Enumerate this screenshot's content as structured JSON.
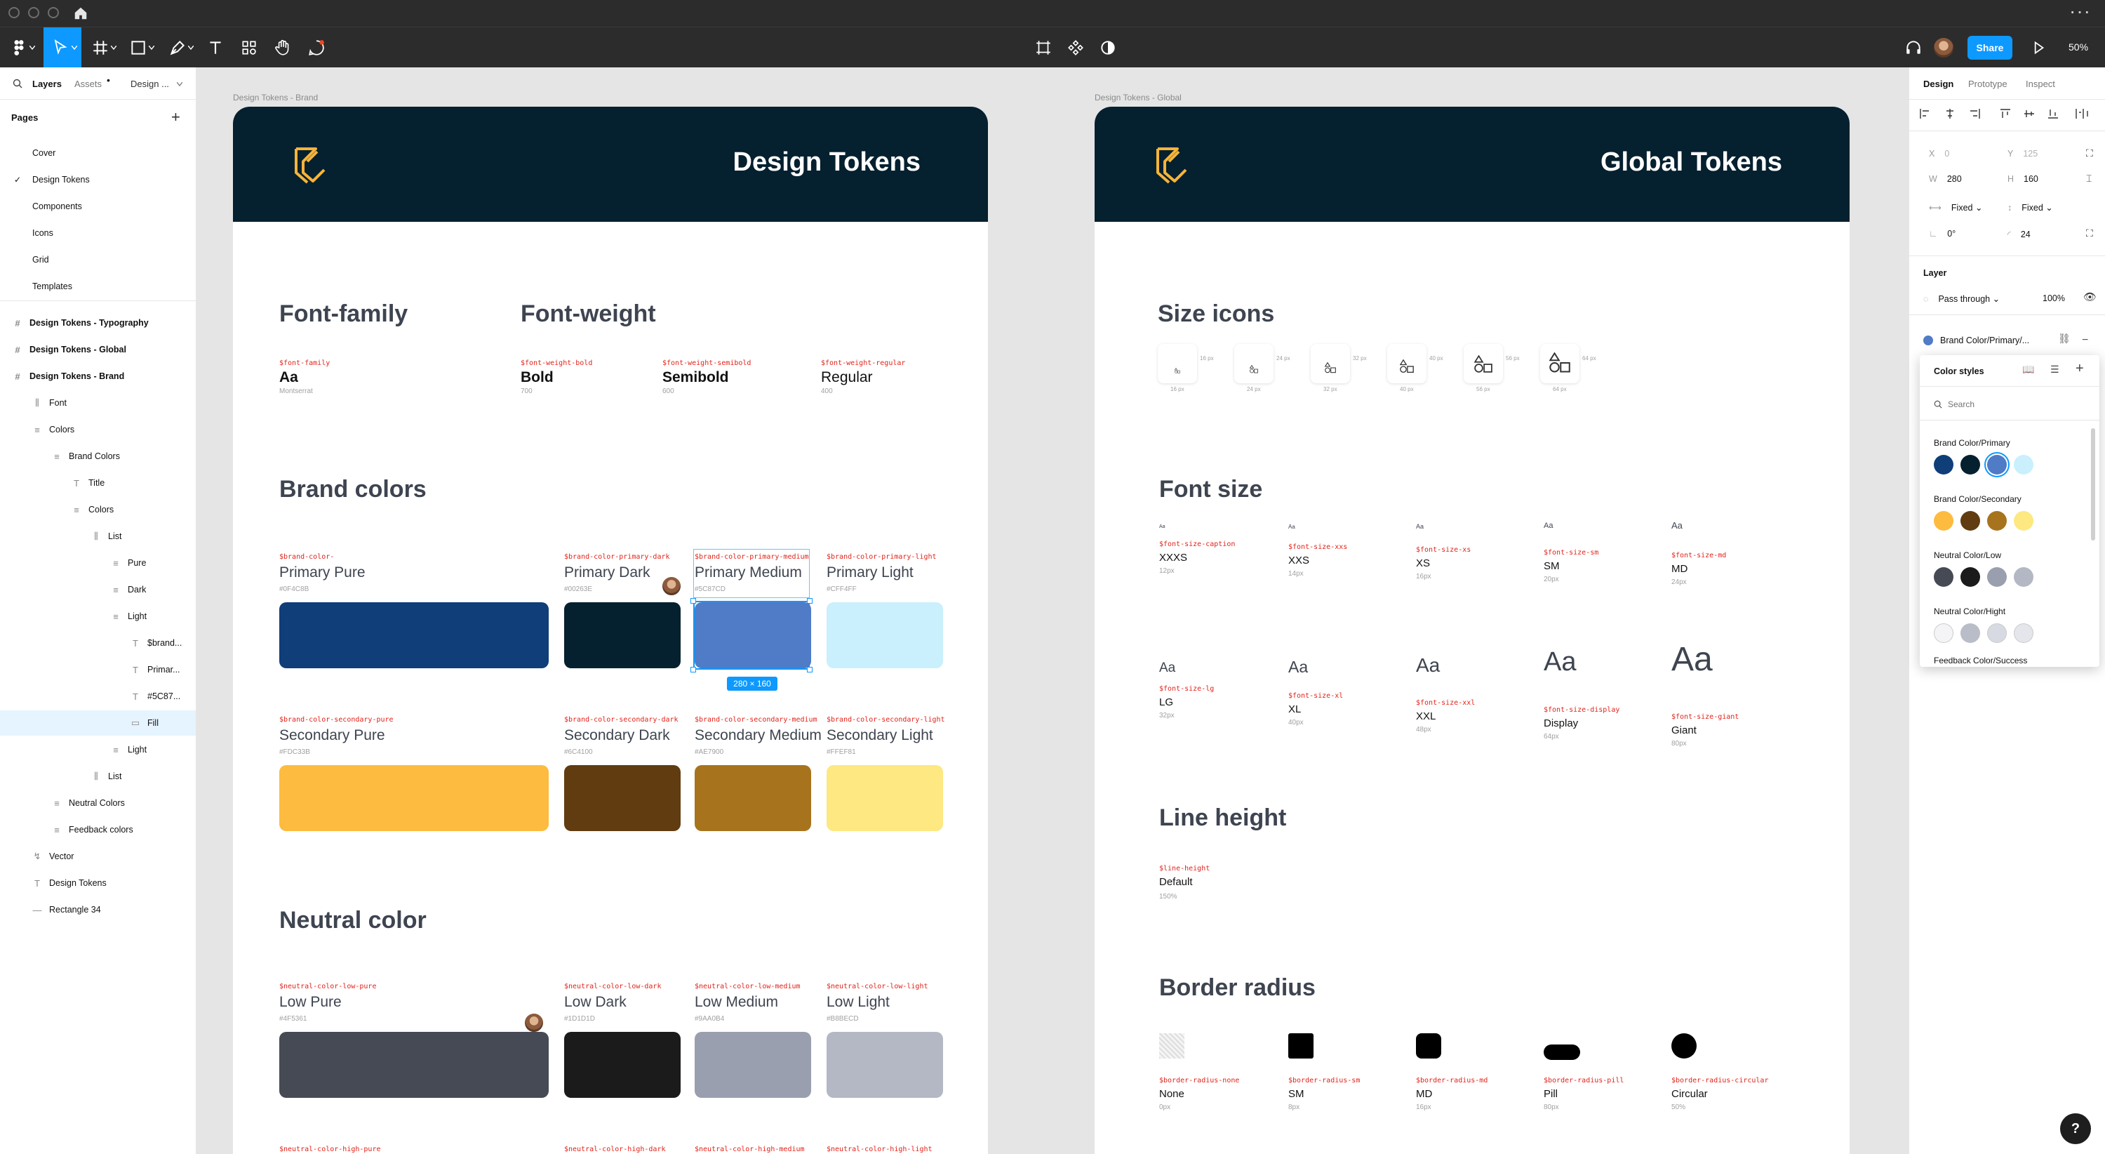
{
  "toolbar": {
    "share": "Share",
    "zoom": "50%"
  },
  "left_panel": {
    "tabs": [
      "Layers",
      "Assets",
      "Design ..."
    ],
    "pages_title": "Pages",
    "pages": [
      "Cover",
      "Design Tokens",
      "Components",
      "Icons",
      "Grid",
      "Templates"
    ],
    "layers": [
      {
        "label": "Design Tokens - Typography",
        "bold": true
      },
      {
        "label": "Design Tokens - Global",
        "bold": true
      },
      {
        "label": "Design Tokens - Brand",
        "bold": true
      },
      {
        "label": "Font"
      },
      {
        "label": "Colors"
      },
      {
        "label": "Brand Colors"
      },
      {
        "label": "Title"
      },
      {
        "label": "Colors"
      },
      {
        "label": "List"
      },
      {
        "label": "Pure"
      },
      {
        "label": "Dark"
      },
      {
        "label": "Light"
      },
      {
        "label": "$brand..."
      },
      {
        "label": "Primar..."
      },
      {
        "label": "#5C87..."
      },
      {
        "label": "Fill",
        "selected": true
      },
      {
        "label": "Light"
      },
      {
        "label": "List"
      },
      {
        "label": "Neutral Colors"
      },
      {
        "label": "Feedback colors"
      },
      {
        "label": "Vector"
      },
      {
        "label": "Design Tokens"
      },
      {
        "label": "Rectangle 34"
      }
    ]
  },
  "brand_frame": {
    "label": "Design Tokens - Brand",
    "title": "Design Tokens",
    "font_family_title": "Font-family",
    "font_weight_title": "Font-weight",
    "font_family": {
      "token": "$font-family",
      "name": "Aa",
      "sub": "Montserrat"
    },
    "weights": [
      {
        "token": "$font-weight-bold",
        "name": "Bold",
        "sub": "700"
      },
      {
        "token": "$font-weight-semibold",
        "name": "Semibold",
        "sub": "600"
      },
      {
        "token": "$font-weight-regular",
        "name": "Regular",
        "sub": "400"
      }
    ],
    "brand_colors_title": "Brand colors",
    "primary": [
      {
        "token": "$brand-color-",
        "name": "Primary Pure",
        "hex": "#0F4C8B",
        "color": "#0f3e78"
      },
      {
        "token": "$brand-color-primary-dark",
        "name": "Primary Dark",
        "hex": "#00263E",
        "color": "#05202f"
      },
      {
        "token": "$brand-color-primary-medium",
        "name": "Primary Medium",
        "hex": "#5C87CD",
        "color": "#4f7bc7"
      },
      {
        "token": "$brand-color-primary-light",
        "name": "Primary Light",
        "hex": "#CFF4FF",
        "color": "#c9f0fc"
      }
    ],
    "secondary": [
      {
        "token": "$brand-color-secondary-pure",
        "name": "Secondary Pure",
        "hex": "#FDC33B",
        "color": "#fdbb40"
      },
      {
        "token": "$brand-color-secondary-dark",
        "name": "Secondary Dark",
        "hex": "#6C4100",
        "color": "#603c10"
      },
      {
        "token": "$brand-color-secondary-medium",
        "name": "Secondary Medium",
        "hex": "#AE7900",
        "color": "#a7741d"
      },
      {
        "token": "$brand-color-secondary-light",
        "name": "Secondary Light",
        "hex": "#FFEF81",
        "color": "#fde882"
      }
    ],
    "size_badge": "280 × 160",
    "neutral_title": "Neutral color",
    "neutral": [
      {
        "token": "$neutral-color-low-pure",
        "name": "Low Pure",
        "hex": "#4F5361",
        "color": "#464a55"
      },
      {
        "token": "$neutral-color-low-dark",
        "name": "Low Dark",
        "hex": "#1D1D1D",
        "color": "#1b1b1b"
      },
      {
        "token": "$neutral-color-low-medium",
        "name": "Low Medium",
        "hex": "#9AA0B4",
        "color": "#999fae"
      },
      {
        "token": "$neutral-color-low-light",
        "name": "Low Light",
        "hex": "#B8BECD",
        "color": "#b3b8c4"
      }
    ],
    "neutral_high": [
      "$neutral-color-high-pure",
      "$neutral-color-high-dark",
      "$neutral-color-high-medium",
      "$neutral-color-high-light"
    ]
  },
  "global_frame": {
    "label": "Design Tokens - Global",
    "title": "Global Tokens",
    "size_icons_title": "Size icons",
    "icon_sizes": [
      {
        "side": "16 px",
        "bottom": "16 px"
      },
      {
        "side": "24 px",
        "bottom": "24 px"
      },
      {
        "side": "32 px",
        "bottom": "32 px"
      },
      {
        "side": "40 px",
        "bottom": "40 px"
      },
      {
        "side": "56 px",
        "bottom": "56 px"
      },
      {
        "side": "64 px",
        "bottom": "64 px"
      }
    ],
    "font_size_title": "Font size",
    "font_sizes": [
      {
        "aa": "Aa",
        "token": "$font-size-caption",
        "name": "XXXS",
        "sub": "12px"
      },
      {
        "aa": "Aa",
        "token": "$font-size-xxs",
        "name": "XXS",
        "sub": "14px"
      },
      {
        "aa": "Aa",
        "token": "$font-size-xs",
        "name": "XS",
        "sub": "16px"
      },
      {
        "aa": "Aa",
        "token": "$font-size-sm",
        "name": "SM",
        "sub": "20px"
      },
      {
        "aa": "Aa",
        "token": "$font-size-md",
        "name": "MD",
        "sub": "24px"
      },
      {
        "aa": "Aa",
        "token": "$font-size-lg",
        "name": "LG",
        "sub": "32px"
      },
      {
        "aa": "Aa",
        "token": "$font-size-xl",
        "name": "XL",
        "sub": "40px"
      },
      {
        "aa": "Aa",
        "token": "$font-size-xxl",
        "name": "XXL",
        "sub": "48px"
      },
      {
        "aa": "Aa",
        "token": "$font-size-display",
        "name": "Display",
        "sub": "64px"
      },
      {
        "aa": "Aa",
        "token": "$font-size-giant",
        "name": "Giant",
        "sub": "80px"
      }
    ],
    "line_height_title": "Line height",
    "line_height": {
      "token": "$line-height",
      "name": "Default",
      "sub": "150%"
    },
    "border_radius_title": "Border radius",
    "radii": [
      {
        "token": "$border-radius-none",
        "name": "None",
        "sub": "0px"
      },
      {
        "token": "$border-radius-sm",
        "name": "SM",
        "sub": "8px"
      },
      {
        "token": "$border-radius-md",
        "name": "MD",
        "sub": "16px"
      },
      {
        "token": "$border-radius-pill",
        "name": "Pill",
        "sub": "80px"
      },
      {
        "token": "$border-radius-circular",
        "name": "Circular",
        "sub": "50%"
      }
    ]
  },
  "right_panel": {
    "tabs": [
      "Design",
      "Prototype",
      "Inspect"
    ],
    "x": "0",
    "y": "125",
    "w": "280",
    "h": "160",
    "w_mode": "Fixed",
    "h_mode": "Fixed",
    "rotation": "0°",
    "radius": "24",
    "layer_title": "Layer",
    "blend": "Pass through",
    "opacity": "100%",
    "fill_style": "Brand Color/Primary/...",
    "color_styles": {
      "title": "Color styles",
      "search_placeholder": "Search",
      "groups": [
        {
          "name": "Brand Color/Primary",
          "colors": [
            "#0f3e78",
            "#05202f",
            "#4f7bc7",
            "#c9f0fc"
          ]
        },
        {
          "name": "Brand Color/Secondary",
          "colors": [
            "#fdbb40",
            "#603c10",
            "#a7741d",
            "#fde882"
          ]
        },
        {
          "name": "Neutral Color/Low",
          "colors": [
            "#464a55",
            "#1b1b1b",
            "#999fae",
            "#b3b8c4"
          ]
        },
        {
          "name": "Neutral Color/Hight",
          "colors": [
            "#f4f4f6",
            "#b9bdc8",
            "#d7dae2",
            "#e4e6ec"
          ]
        }
      ],
      "cut_group": "Feedback Color/Success"
    }
  },
  "help": "?"
}
